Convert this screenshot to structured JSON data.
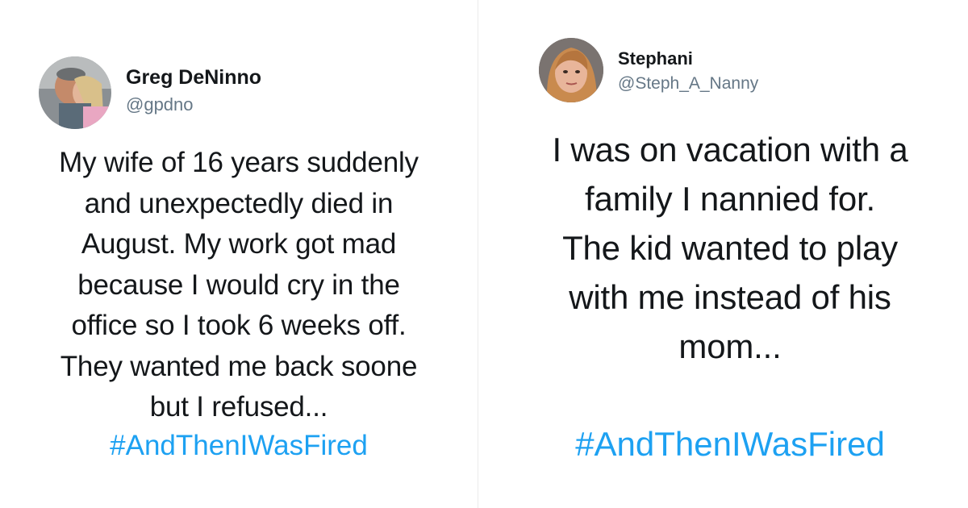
{
  "colors": {
    "text": "#14171a",
    "handle": "#657786",
    "hashtag": "#1da1f2",
    "divider": "#ececec"
  },
  "tweets": [
    {
      "name": "Greg DeNinno",
      "handle": "@gpdno",
      "avatar": "profile-photo",
      "body_lines": [
        "My wife of 16 years suddenly",
        "and unexpectedly died in",
        "August. My work got mad",
        "because I would cry in the",
        "office so I took 6 weeks off.",
        "They wanted me back soone",
        "but I refused..."
      ],
      "hashtag": "#AndThenIWasFired"
    },
    {
      "name": "Stephani",
      "handle": "@Steph_A_Nanny",
      "avatar": "profile-photo",
      "body_lines": [
        "I was on vacation with a",
        "family I nannied for.",
        "The kid wanted to play",
        "with me instead of his",
        "mom..."
      ],
      "hashtag": "#AndThenIWasFired"
    }
  ]
}
